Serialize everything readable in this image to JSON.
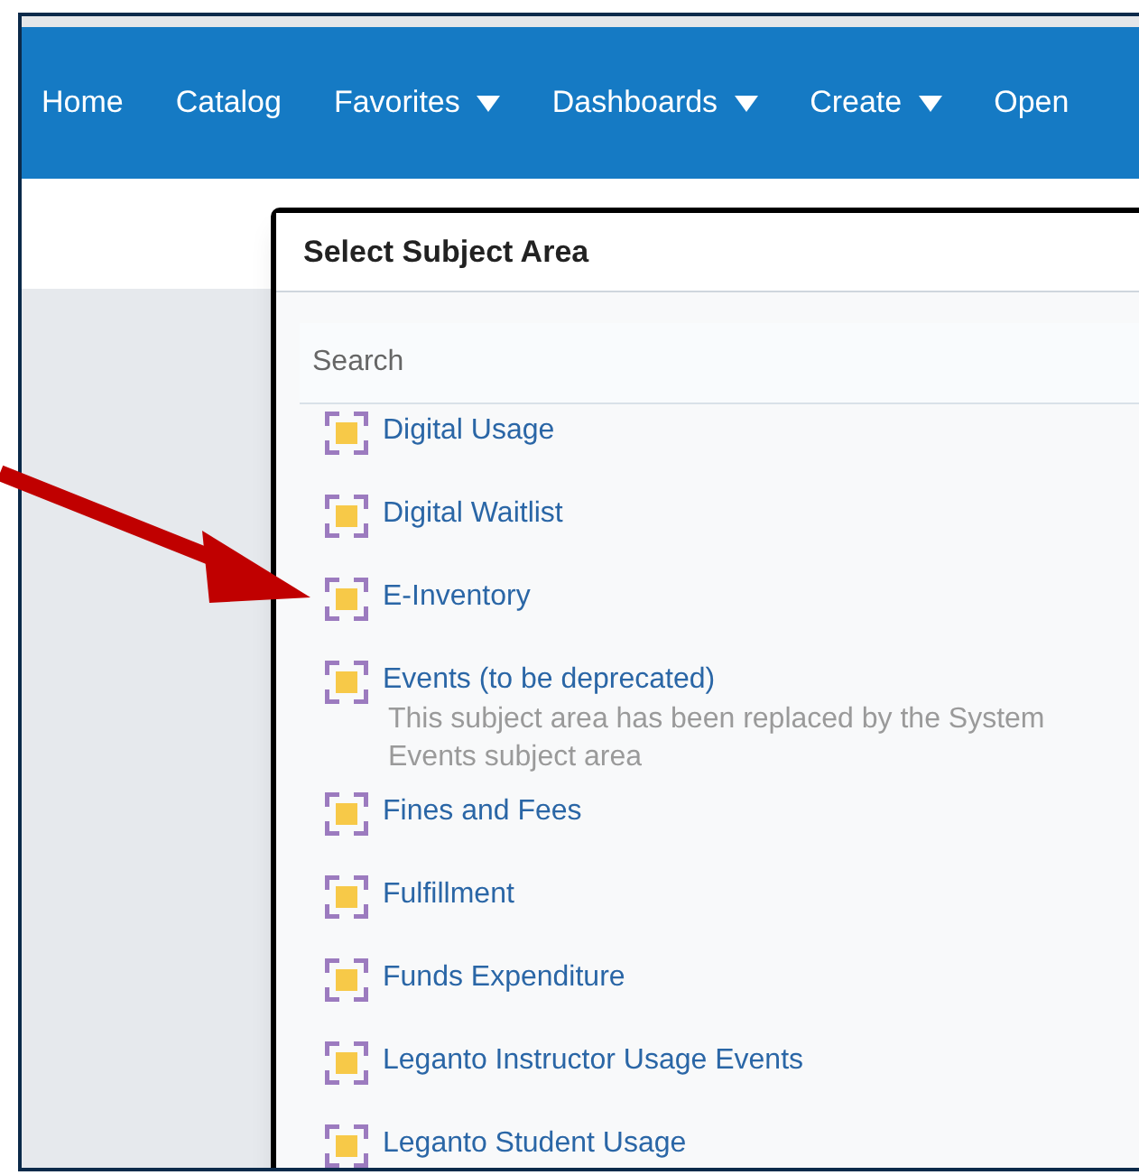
{
  "nav": [
    {
      "label": "Home",
      "dropdown": false
    },
    {
      "label": "Catalog",
      "dropdown": false
    },
    {
      "label": "Favorites",
      "dropdown": true
    },
    {
      "label": "Dashboards",
      "dropdown": true
    },
    {
      "label": "Create",
      "dropdown": true
    },
    {
      "label": "Open",
      "dropdown": false
    }
  ],
  "dialog": {
    "title": "Select Subject Area",
    "search": {
      "placeholder": "Search"
    },
    "items": [
      {
        "label": "Digital Usage"
      },
      {
        "label": "Digital Waitlist"
      },
      {
        "label": "E-Inventory"
      },
      {
        "label": "Events (to be deprecated)",
        "description": "This subject area has been replaced by the System Events subject area"
      },
      {
        "label": "Fines and Fees"
      },
      {
        "label": "Fulfillment"
      },
      {
        "label": "Funds Expenditure"
      },
      {
        "label": "Leganto Instructor Usage Events"
      },
      {
        "label": "Leganto Student Usage"
      }
    ]
  }
}
